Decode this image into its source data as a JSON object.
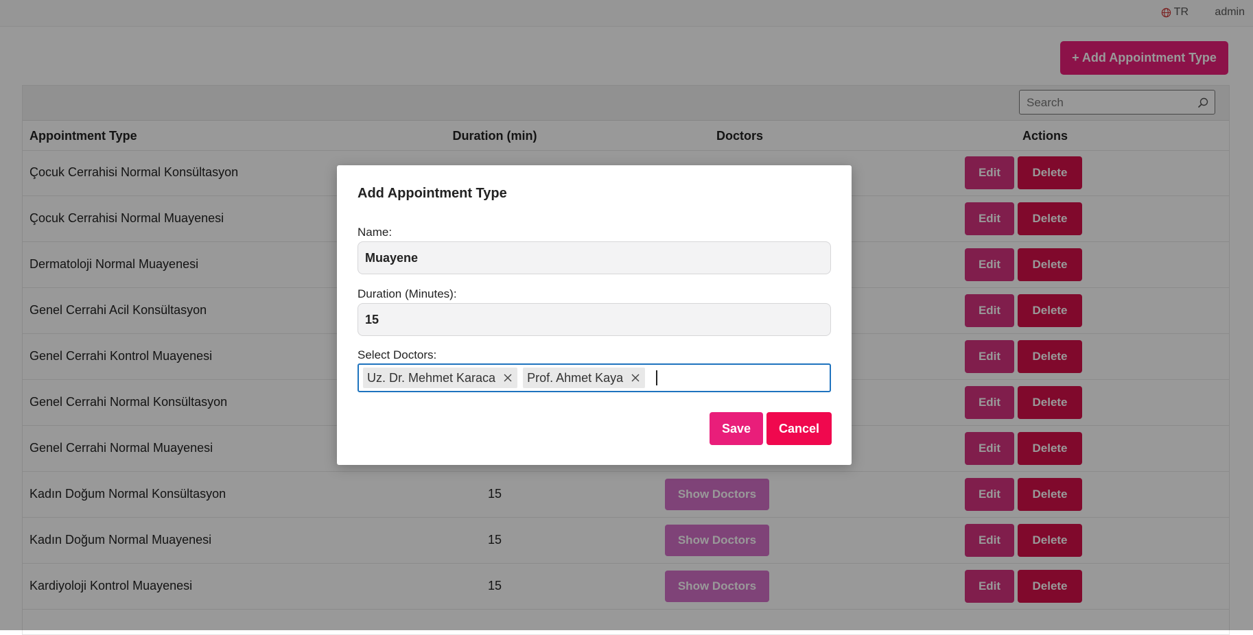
{
  "topbar": {
    "language": "TR",
    "user": "admin"
  },
  "add_button_label": "+ Add Appointment Type",
  "search": {
    "placeholder": "Search"
  },
  "table": {
    "headers": {
      "type": "Appointment Type",
      "duration": "Duration (min)",
      "doctors": "Doctors",
      "actions": "Actions"
    },
    "rows": [
      {
        "type": "Çocuk Cerrahisi Normal Konsültasyon",
        "duration": "",
        "show_doctors": ""
      },
      {
        "type": "Çocuk Cerrahisi Normal Muayenesi",
        "duration": "",
        "show_doctors": ""
      },
      {
        "type": "Dermatoloji Normal Muayenesi",
        "duration": "",
        "show_doctors": ""
      },
      {
        "type": "Genel Cerrahi Acil Konsültasyon",
        "duration": "",
        "show_doctors": ""
      },
      {
        "type": "Genel Cerrahi Kontrol Muayenesi",
        "duration": "",
        "show_doctors": ""
      },
      {
        "type": "Genel Cerrahi Normal Konsültasyon",
        "duration": "",
        "show_doctors": ""
      },
      {
        "type": "Genel Cerrahi Normal Muayenesi",
        "duration": "",
        "show_doctors": ""
      },
      {
        "type": "Kadın Doğum Normal Konsültasyon",
        "duration": "15",
        "show_doctors": "Show Doctors"
      },
      {
        "type": "Kadın Doğum Normal Muayenesi",
        "duration": "15",
        "show_doctors": "Show Doctors"
      },
      {
        "type": "Kardiyoloji Kontrol Muayenesi",
        "duration": "15",
        "show_doctors": "Show Doctors"
      }
    ],
    "edit_label": "Edit",
    "delete_label": "Delete"
  },
  "modal": {
    "title": "Add Appointment Type",
    "name_label": "Name:",
    "name_value": "Muayene",
    "duration_label": "Duration (Minutes):",
    "duration_value": "15",
    "doctors_label": "Select Doctors:",
    "selected_doctors": [
      "Uz. Dr. Mehmet Karaca",
      "Prof. Ahmet Kaya"
    ],
    "save_label": "Save",
    "cancel_label": "Cancel"
  },
  "colors": {
    "accent": "#e91e7a",
    "danger": "#f0084e",
    "doctor_button": "#d470c8",
    "focus": "#1e73be"
  },
  "icons": {
    "language": "globe-icon",
    "search": "search-icon",
    "remove_tag": "close-icon"
  }
}
